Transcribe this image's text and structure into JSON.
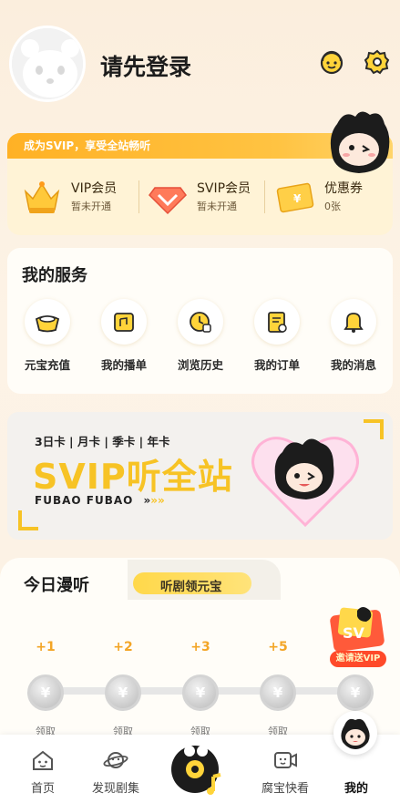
{
  "header": {
    "login_prompt": "请先登录",
    "icons": [
      "customer-service-icon",
      "settings-gear-icon"
    ]
  },
  "vip_card": {
    "promo_text": "成为SVIP，享受全站畅听",
    "items": [
      {
        "title": "VIP会员",
        "status": "暂未开通",
        "icon": "crown-icon"
      },
      {
        "title": "SVIP会员",
        "status": "暂未开通",
        "icon": "diamond-icon"
      },
      {
        "title": "优惠券",
        "status": "0张",
        "icon": "ticket-icon"
      }
    ]
  },
  "services": {
    "title": "我的服务",
    "items": [
      {
        "label": "元宝充值",
        "icon": "ingot-icon"
      },
      {
        "label": "我的播单",
        "icon": "playlist-icon"
      },
      {
        "label": "浏览历史",
        "icon": "history-clock-icon"
      },
      {
        "label": "我的订单",
        "icon": "order-clipboard-icon"
      },
      {
        "label": "我的消息",
        "icon": "bell-icon"
      }
    ]
  },
  "banner": {
    "cards": "3日卡 | 月卡 | 季卡 | 年卡",
    "title": "SVIP听全站",
    "subtitle": "FUBAO FUBAO"
  },
  "today": {
    "title": "今日漫听",
    "subtitle": "听剧领元宝",
    "rewards": [
      {
        "amount": "+1",
        "claim": "领取"
      },
      {
        "amount": "+2",
        "claim": "领取"
      },
      {
        "amount": "+3",
        "claim": "领取"
      },
      {
        "amount": "+5",
        "claim": "领取"
      },
      {
        "amount": "",
        "claim": "领取"
      }
    ],
    "coin_symbol": "¥",
    "invite_label": "邀请送VIP"
  },
  "tabbar": {
    "items": [
      {
        "label": "首页",
        "icon": "home-icon"
      },
      {
        "label": "发现剧集",
        "icon": "planet-icon"
      },
      {
        "label": "",
        "icon": "center-cd-icon"
      },
      {
        "label": "腐宝快看",
        "icon": "video-icon"
      },
      {
        "label": "我的",
        "icon": "profile-icon",
        "active": true
      }
    ]
  },
  "colors": {
    "accent": "#f7c325",
    "orange": "#ffb125",
    "background": "#fbeedd"
  }
}
